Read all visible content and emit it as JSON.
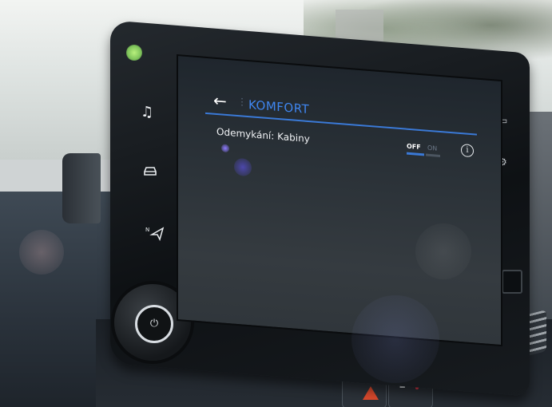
{
  "screen": {
    "header": {
      "back_icon": "arrow-left-icon",
      "separator": "⋮",
      "title": "KOMFORT"
    },
    "setting": {
      "label": "Odemykání: Kabiny",
      "toggle": {
        "off_label": "OFF",
        "on_label": "ON",
        "selected": "OFF"
      },
      "info_icon": "info-icon"
    }
  },
  "side_controls": {
    "icons": [
      "music-note-icon",
      "car-icon",
      "navigation-icon"
    ],
    "knob_icon": "power-icon"
  },
  "colors": {
    "accent": "#3a79d6",
    "title": "#3f86f0",
    "text": "#f1f3f5",
    "screen_bg": "#2b3238"
  }
}
